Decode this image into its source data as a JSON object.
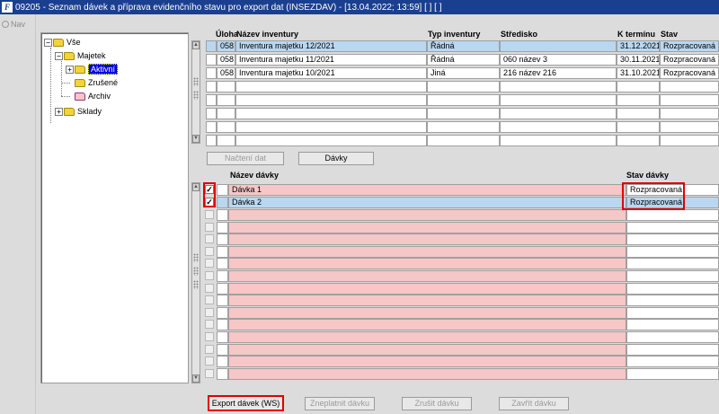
{
  "window": {
    "title": "09205 - Seznam dávek a příprava evidenčního stavu pro export dat (INSEZDAV) - [13.04.2022; 13:59]  [ ]  [ ]",
    "app_icon_letter": "F"
  },
  "nav": {
    "label": "Nav"
  },
  "tree": {
    "root": "Vše",
    "majetek": "Majetek",
    "aktivni": "Aktivní",
    "zrusene": "Zrušené",
    "archiv": "Archiv",
    "sklady": "Sklady"
  },
  "inventory_grid": {
    "columns": {
      "uloha": "Úloha",
      "nazev": "Název inventury",
      "typ": "Typ inventury",
      "stredisko": "Středisko",
      "k_terminu": "K termínu",
      "stav": "Stav"
    },
    "rows": [
      {
        "uloha": "058",
        "nazev": "Inventura majetku 12/2021",
        "typ": "Řádná",
        "stredisko": "",
        "k_terminu": "31.12.2021",
        "stav": "Rozpracovaná"
      },
      {
        "uloha": "058",
        "nazev": "Inventura majetku 11/2021",
        "typ": "Řádná",
        "stredisko": "060 název 3",
        "k_terminu": "30.11.2021",
        "stav": "Rozpracovaná"
      },
      {
        "uloha": "058",
        "nazev": "Inventura majetku 10/2021",
        "typ": "Jiná",
        "stredisko": "216 název 216",
        "k_terminu": "31.10.2021",
        "stav": "Rozpracovaná"
      }
    ]
  },
  "mid_buttons": {
    "nacteni_dat": "Načtení dat",
    "davky": "Dávky"
  },
  "batch_grid": {
    "columns": {
      "nazev_davky": "Název dávky",
      "stav_davky": "Stav dávky"
    },
    "rows": [
      {
        "checked": true,
        "nazev": "Dávka 1",
        "stav": "Rozpracovaná"
      },
      {
        "checked": true,
        "nazev": "Dávka 2",
        "stav": "Rozpracovaná"
      }
    ]
  },
  "bottom_buttons": {
    "export": "Export dávek (WS)",
    "zneplatnit": "Zneplatnit dávku",
    "zrusit": "Zrušit dávku",
    "zavrit": "Zavřít dávku"
  }
}
